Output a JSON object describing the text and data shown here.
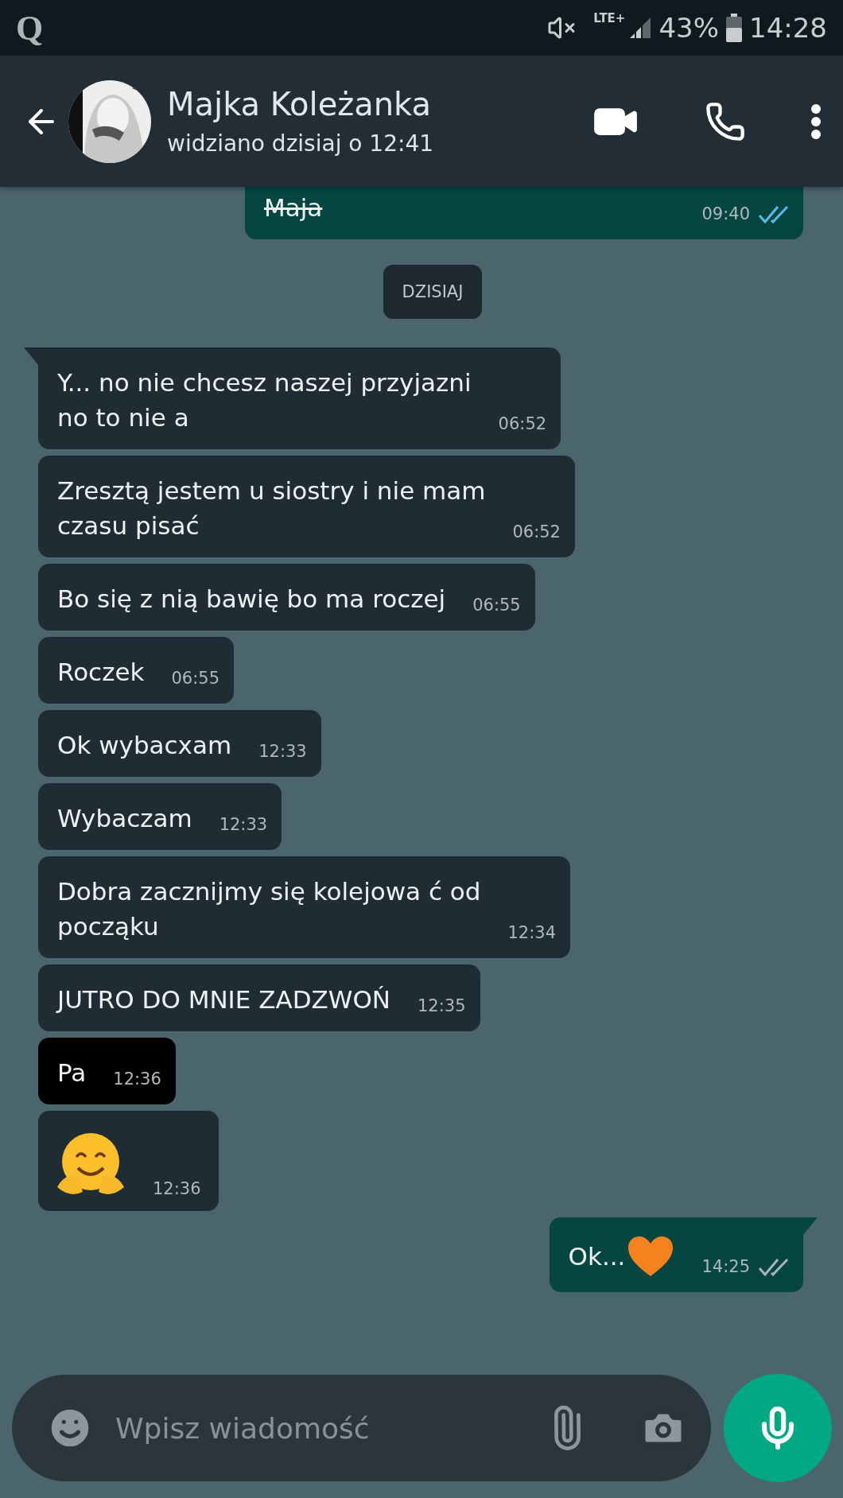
{
  "status_bar": {
    "app_letter": "Q",
    "network": "LTE+",
    "battery": "43%",
    "time": "14:28"
  },
  "header": {
    "name": "Majka Koleżanka",
    "last_seen": "widziano dzisiaj o 12:41"
  },
  "messages": [
    {
      "kind": "outgoing",
      "text": "Maja",
      "struck": true,
      "time": "09:40",
      "read": true,
      "tail": false
    },
    {
      "kind": "date",
      "text": "DZISIAJ"
    },
    {
      "kind": "incoming",
      "text": "Y... no nie chcesz naszej przyjazni\nno to nie a",
      "time": "06:52",
      "selected": false,
      "tail": true
    },
    {
      "kind": "incoming",
      "text": "Zresztą jestem u siostry i nie mam\nczasu pisać",
      "time": "06:52",
      "selected": false,
      "tail": false
    },
    {
      "kind": "incoming",
      "text": "Bo się z nią bawię bo ma roczej",
      "time": "06:55",
      "selected": false,
      "tail": false
    },
    {
      "kind": "incoming",
      "text": "Roczek",
      "time": "06:55",
      "selected": false,
      "tail": false
    },
    {
      "kind": "incoming",
      "text": "Ok wybacxam",
      "time": "12:33",
      "selected": false,
      "tail": false
    },
    {
      "kind": "incoming",
      "text": "Wybaczam",
      "time": "12:33",
      "selected": false,
      "tail": false
    },
    {
      "kind": "incoming",
      "text": "Dobra zacznijmy się kolejowa ć    od\npocząku",
      "time": "12:34",
      "selected": false,
      "tail": false
    },
    {
      "kind": "incoming",
      "text": "JUTRO DO MNIE ZADZWOŃ",
      "time": "12:35",
      "selected": false,
      "tail": false
    },
    {
      "kind": "incoming",
      "text": "Pa",
      "time": "12:36",
      "selected": true,
      "tail": false
    },
    {
      "kind": "incoming_emoji",
      "time": "12:36",
      "selected": false,
      "tail": false
    },
    {
      "kind": "outgoing_heart",
      "text": "Ok...",
      "time": "14:25",
      "read": false,
      "tail": true
    }
  ],
  "composer": {
    "placeholder": "Wpisz wiadomość"
  }
}
